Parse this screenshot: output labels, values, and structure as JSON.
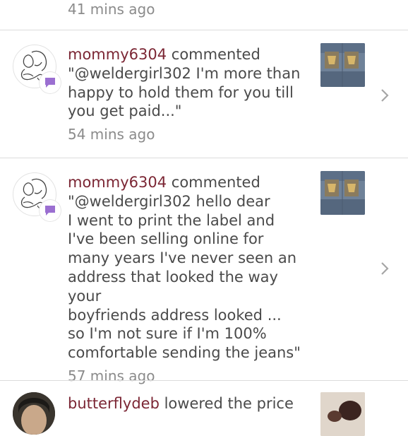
{
  "top": {
    "time": "41 mins ago"
  },
  "items": [
    {
      "user": "mommy6304",
      "action": "commented",
      "comment": "\"@weldergirl302 I'm more than\nhappy to hold them for you till\nyou get paid...\"",
      "time": "54 mins ago"
    },
    {
      "user": "mommy6304",
      "action": "commented",
      "comment": "\"@weldergirl302 hello dear\nI went to print the label and\nI've been selling online for\nmany years I've never seen an\naddress that looked the way your\nboyfriends address looked ...\nso I'm not sure if I'm 100%\ncomfortable sending the jeans\"",
      "time": "57 mins ago"
    },
    {
      "user": "butterflydeb",
      "action": "lowered the price"
    }
  ],
  "colors": {
    "username": "#7b2634",
    "text": "#4a4a4a",
    "time": "#8b8b8b",
    "badge": "#9b6fd1",
    "divider": "#dcdcdc"
  },
  "icons": {
    "avatar": "mom-and-baby-sketch-icon",
    "badge": "comment-bubble-icon",
    "chevron": "chevron-right-icon"
  }
}
